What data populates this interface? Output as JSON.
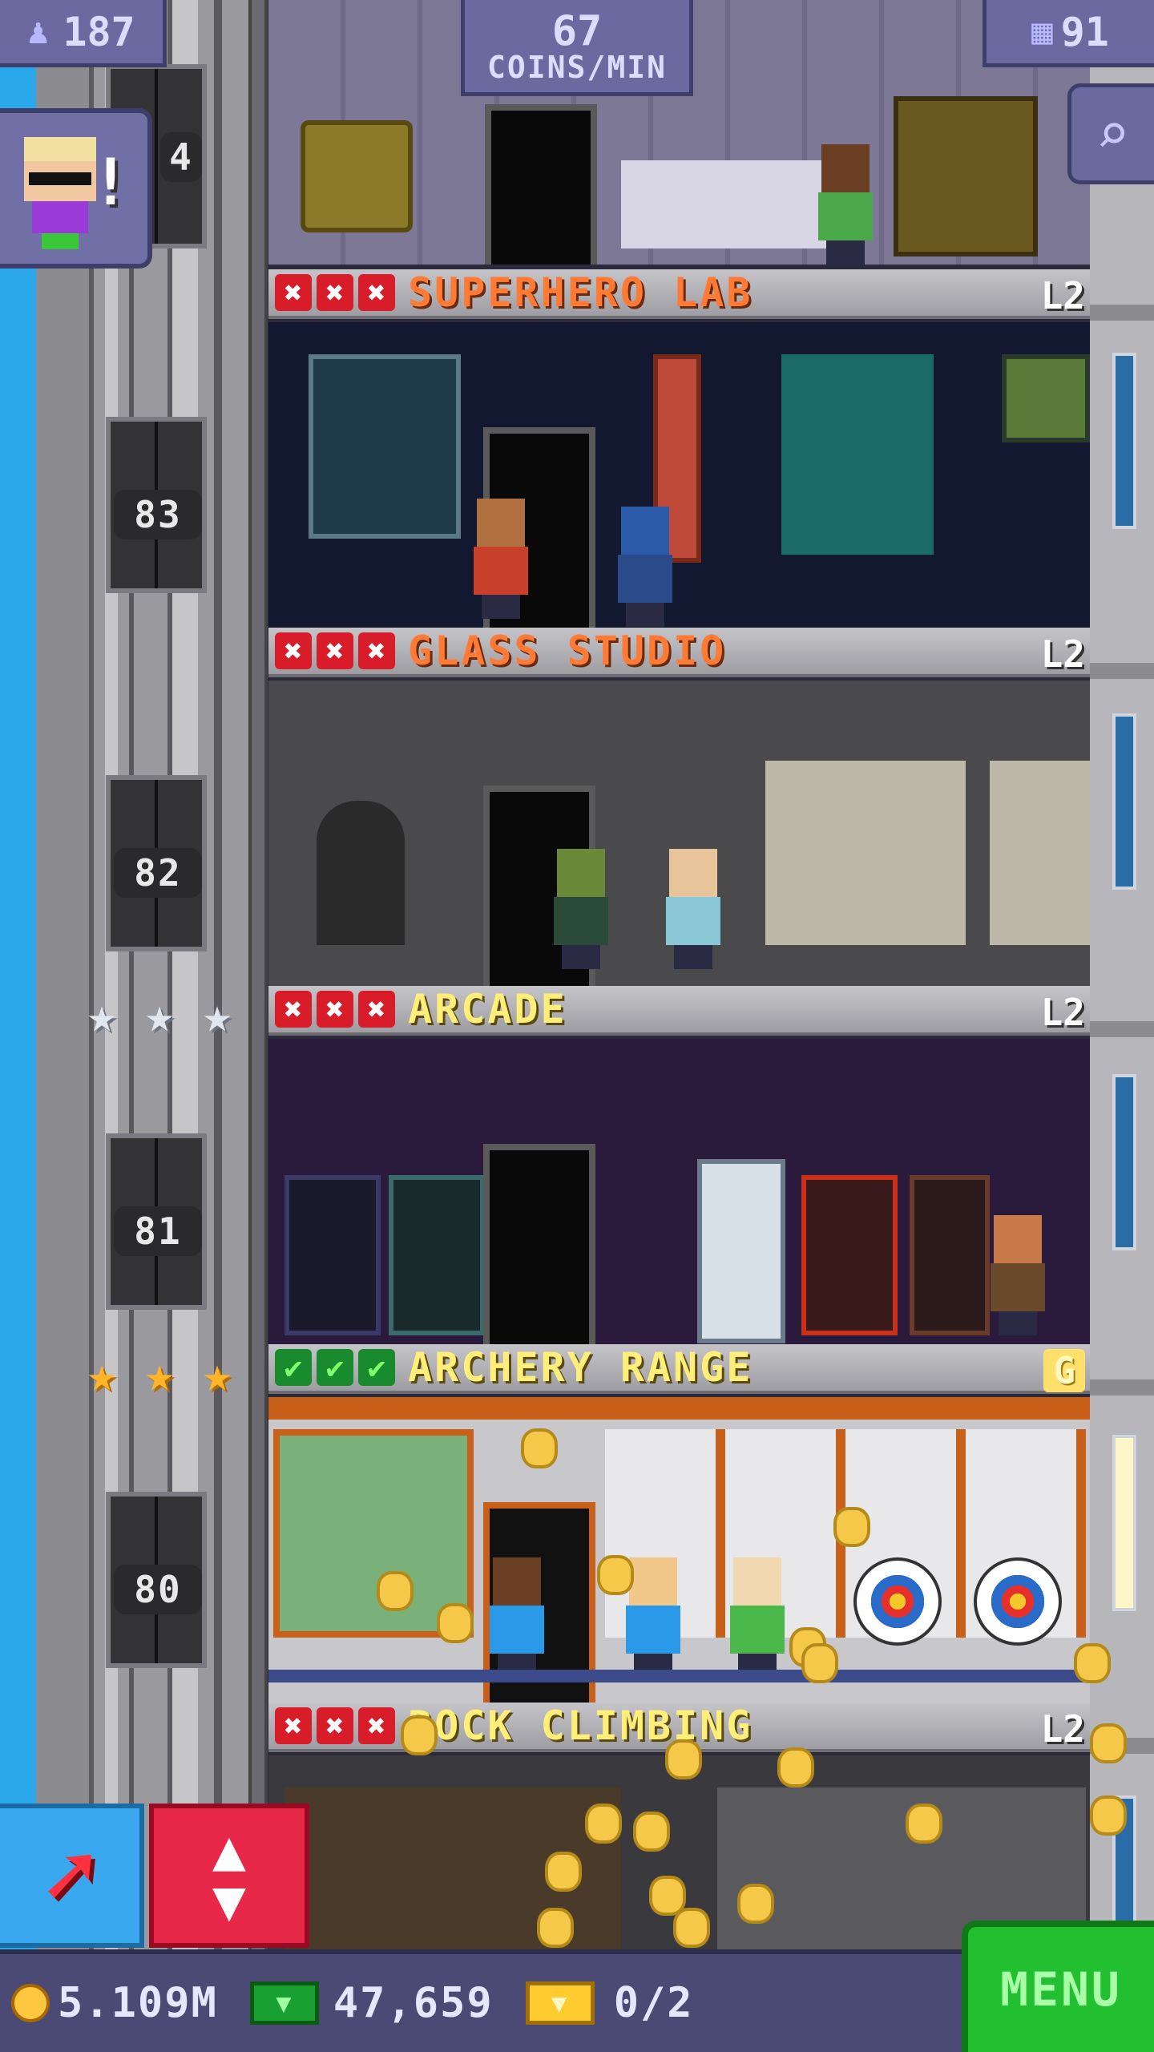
{
  "hud": {
    "population": "187",
    "coins_per_min_value": "67",
    "coins_per_min_unit": "COINS/MIN",
    "floors": "91"
  },
  "elevator": {
    "partial_floor_label": "4",
    "floor_numbers": [
      "83",
      "82",
      "81",
      "80"
    ]
  },
  "floors": [
    {
      "name": "SUPERHERO LAB",
      "level": "L2",
      "status": [
        "x",
        "x",
        "x"
      ],
      "name_color": "#ff7a34"
    },
    {
      "name": "GLASS STUDIO",
      "level": "L2",
      "status": [
        "x",
        "x",
        "x"
      ],
      "name_color": "#ff7a34"
    },
    {
      "name": "ARCADE",
      "level": "L2",
      "status": [
        "x",
        "x",
        "x"
      ],
      "name_color": "#ffee7a"
    },
    {
      "name": "ARCHERY RANGE",
      "level": "G",
      "status": [
        "check",
        "check",
        "check"
      ],
      "name_color": "#ffee7a"
    },
    {
      "name": "ROCK CLIMBING",
      "level": "L2",
      "status": [
        "x",
        "x",
        "x"
      ],
      "name_color": "#ffee7a"
    }
  ],
  "stars": {
    "arcade_row": {
      "type": "silver",
      "count": 3
    },
    "archery_row": {
      "type": "gold",
      "count": 3
    }
  },
  "bottom": {
    "coins": "5.109M",
    "bux": "47,659",
    "tickets": "0/2",
    "menu_label": "MENU"
  },
  "icons": {
    "population": "person-up-icon",
    "floors": "building-icon",
    "search": "magnifier-icon",
    "rocket": "arrow-icon",
    "elevator": "up-down-icon"
  },
  "colors": {
    "hud": "#6a6aa0",
    "menu": "#22c030",
    "red_button": "#e82848",
    "blue_button": "#3aa8ee"
  }
}
